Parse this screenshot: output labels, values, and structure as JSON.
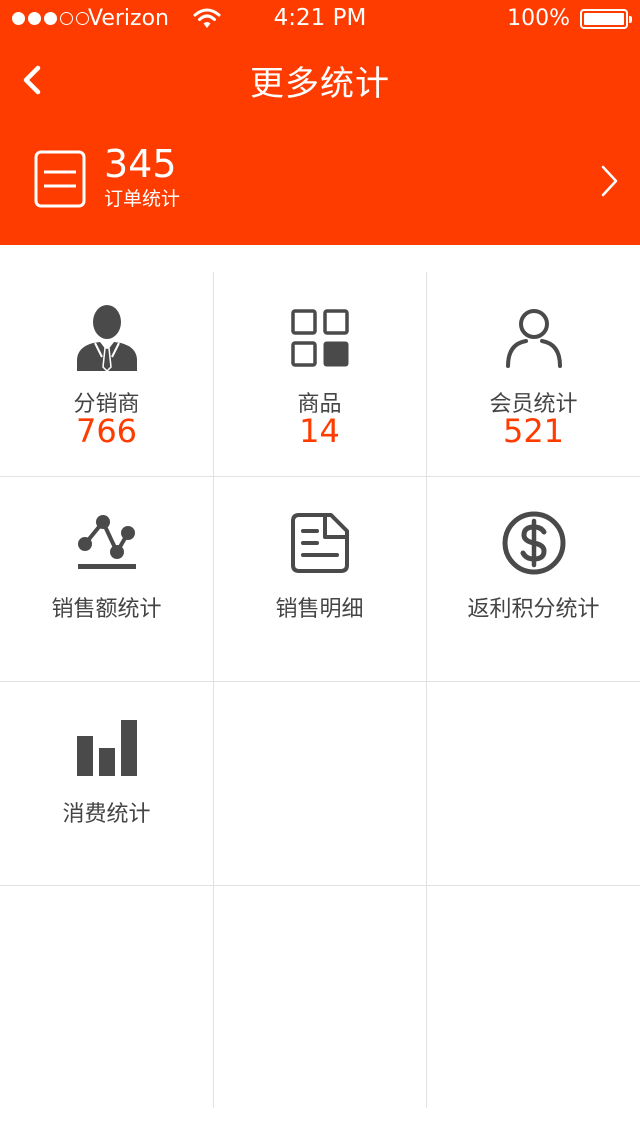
{
  "status_bar": {
    "carrier": "Verizon",
    "time": "4:21 PM",
    "battery": "100%"
  },
  "nav": {
    "title": "更多统计"
  },
  "order_summary": {
    "count": "345",
    "label": "订单统计"
  },
  "grid": {
    "items": [
      {
        "label": "分销商",
        "count": "766",
        "icon": "distributor-icon"
      },
      {
        "label": "商品",
        "count": "14",
        "icon": "products-grid-icon"
      },
      {
        "label": "会员统计",
        "count": "521",
        "icon": "member-icon"
      },
      {
        "label": "销售额统计",
        "icon": "sales-chart-icon"
      },
      {
        "label": "销售明细",
        "icon": "sales-detail-icon"
      },
      {
        "label": "返利积分统计",
        "icon": "dollar-coin-icon"
      },
      {
        "label": "消费统计",
        "icon": "bar-chart-icon"
      }
    ]
  },
  "colors": {
    "accent": "#ff3c00",
    "icon": "#4a4a4a",
    "divider": "#e2e2e2"
  }
}
